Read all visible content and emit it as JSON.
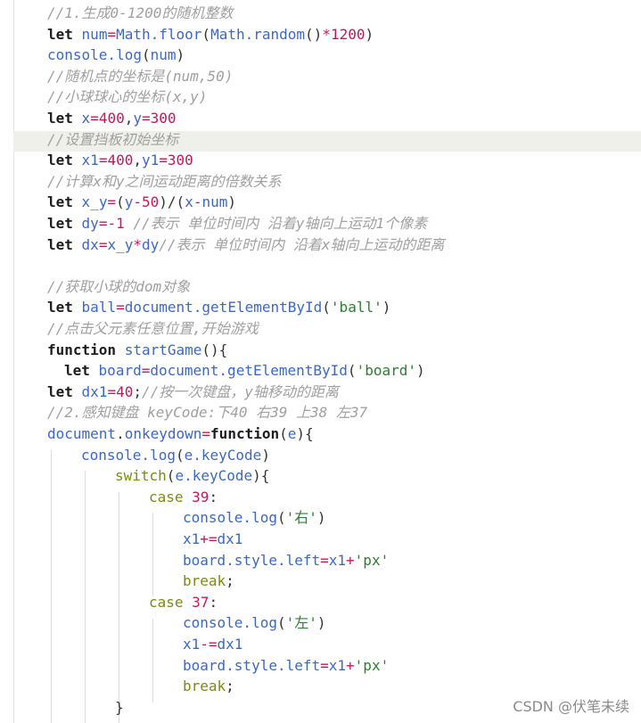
{
  "editor": {
    "language": "javascript",
    "highlighted_line": 7,
    "lines": [
      {
        "indent": 0,
        "tokens": [
          {
            "t": "comment",
            "v": "//1.生成0-1200的随机整数"
          }
        ]
      },
      {
        "indent": 0,
        "tokens": [
          {
            "t": "keyword",
            "v": "let"
          },
          {
            "t": "plain",
            "v": " "
          },
          {
            "t": "variable",
            "v": "num"
          },
          {
            "t": "op",
            "v": "="
          },
          {
            "t": "fn",
            "v": "Math.floor"
          },
          {
            "t": "plain",
            "v": "("
          },
          {
            "t": "fn",
            "v": "Math.random"
          },
          {
            "t": "plain",
            "v": "()"
          },
          {
            "t": "op",
            "v": "*"
          },
          {
            "t": "number",
            "v": "1200"
          },
          {
            "t": "plain",
            "v": ")"
          }
        ]
      },
      {
        "indent": 0,
        "tokens": [
          {
            "t": "fn",
            "v": "console.log"
          },
          {
            "t": "plain",
            "v": "("
          },
          {
            "t": "variable",
            "v": "num"
          },
          {
            "t": "plain",
            "v": ")"
          }
        ]
      },
      {
        "indent": 0,
        "tokens": [
          {
            "t": "comment",
            "v": "//随机点的坐标是(num,50)"
          }
        ]
      },
      {
        "indent": 0,
        "tokens": [
          {
            "t": "comment",
            "v": "//小球球心的坐标(x,y)"
          }
        ]
      },
      {
        "indent": 0,
        "tokens": [
          {
            "t": "keyword",
            "v": "let"
          },
          {
            "t": "plain",
            "v": " "
          },
          {
            "t": "variable",
            "v": "x"
          },
          {
            "t": "op",
            "v": "="
          },
          {
            "t": "number",
            "v": "400"
          },
          {
            "t": "plain",
            "v": ","
          },
          {
            "t": "variable",
            "v": "y"
          },
          {
            "t": "op",
            "v": "="
          },
          {
            "t": "number",
            "v": "300"
          }
        ]
      },
      {
        "indent": 0,
        "tokens": [
          {
            "t": "comment",
            "v": "//设置挡板初始坐标"
          }
        ]
      },
      {
        "indent": 0,
        "tokens": [
          {
            "t": "keyword",
            "v": "let"
          },
          {
            "t": "plain",
            "v": " "
          },
          {
            "t": "variable",
            "v": "x1"
          },
          {
            "t": "op",
            "v": "="
          },
          {
            "t": "number",
            "v": "400"
          },
          {
            "t": "plain",
            "v": ","
          },
          {
            "t": "variable",
            "v": "y1"
          },
          {
            "t": "op",
            "v": "="
          },
          {
            "t": "number",
            "v": "300"
          }
        ]
      },
      {
        "indent": 0,
        "tokens": [
          {
            "t": "comment",
            "v": "//计算x和y之间运动距离的倍数关系"
          }
        ]
      },
      {
        "indent": 0,
        "tokens": [
          {
            "t": "keyword",
            "v": "let"
          },
          {
            "t": "plain",
            "v": " "
          },
          {
            "t": "variable",
            "v": "x_y"
          },
          {
            "t": "op",
            "v": "="
          },
          {
            "t": "plain",
            "v": "("
          },
          {
            "t": "variable",
            "v": "y"
          },
          {
            "t": "op",
            "v": "-"
          },
          {
            "t": "number",
            "v": "50"
          },
          {
            "t": "plain",
            "v": ")/("
          },
          {
            "t": "variable",
            "v": "x"
          },
          {
            "t": "op",
            "v": "-"
          },
          {
            "t": "variable",
            "v": "num"
          },
          {
            "t": "plain",
            "v": ")"
          }
        ]
      },
      {
        "indent": 0,
        "tokens": [
          {
            "t": "keyword",
            "v": "let"
          },
          {
            "t": "plain",
            "v": " "
          },
          {
            "t": "variable",
            "v": "dy"
          },
          {
            "t": "op",
            "v": "=-"
          },
          {
            "t": "number",
            "v": "1"
          },
          {
            "t": "plain",
            "v": " "
          },
          {
            "t": "comment",
            "v": "//表示 单位时间内 沿着y轴向上运动1个像素"
          }
        ]
      },
      {
        "indent": 0,
        "tokens": [
          {
            "t": "keyword",
            "v": "let"
          },
          {
            "t": "plain",
            "v": " "
          },
          {
            "t": "variable",
            "v": "dx"
          },
          {
            "t": "op",
            "v": "="
          },
          {
            "t": "variable",
            "v": "x_y"
          },
          {
            "t": "op",
            "v": "*"
          },
          {
            "t": "variable",
            "v": "dy"
          },
          {
            "t": "comment",
            "v": "//表示 单位时间内 沿着x轴向上运动的距离"
          }
        ]
      },
      {
        "indent": 0,
        "tokens": []
      },
      {
        "indent": 0,
        "tokens": [
          {
            "t": "comment",
            "v": "//获取小球的dom对象"
          }
        ]
      },
      {
        "indent": 0,
        "tokens": [
          {
            "t": "keyword",
            "v": "let"
          },
          {
            "t": "plain",
            "v": " "
          },
          {
            "t": "variable",
            "v": "ball"
          },
          {
            "t": "op",
            "v": "="
          },
          {
            "t": "fn",
            "v": "document.getElementById"
          },
          {
            "t": "plain",
            "v": "("
          },
          {
            "t": "string",
            "v": "'ball'"
          },
          {
            "t": "plain",
            "v": ")"
          }
        ]
      },
      {
        "indent": 0,
        "tokens": [
          {
            "t": "comment",
            "v": "//点击父元素任意位置,开始游戏"
          }
        ]
      },
      {
        "indent": 0,
        "tokens": [
          {
            "t": "keyword",
            "v": "function"
          },
          {
            "t": "plain",
            "v": " "
          },
          {
            "t": "fn",
            "v": "startGame"
          },
          {
            "t": "plain",
            "v": "(){"
          }
        ]
      },
      {
        "indent": 1,
        "tokens": [
          {
            "t": "keyword",
            "v": "let"
          },
          {
            "t": "plain",
            "v": " "
          },
          {
            "t": "variable",
            "v": "board"
          },
          {
            "t": "op",
            "v": "="
          },
          {
            "t": "fn",
            "v": "document.getElementById"
          },
          {
            "t": "plain",
            "v": "("
          },
          {
            "t": "string",
            "v": "'board'"
          },
          {
            "t": "plain",
            "v": ")"
          }
        ]
      },
      {
        "indent": 0,
        "tokens": [
          {
            "t": "keyword",
            "v": "let"
          },
          {
            "t": "plain",
            "v": " "
          },
          {
            "t": "variable",
            "v": "dx1"
          },
          {
            "t": "op",
            "v": "="
          },
          {
            "t": "number",
            "v": "40"
          },
          {
            "t": "plain",
            "v": ";"
          },
          {
            "t": "comment",
            "v": "//按一次键盘，y轴移动的距离"
          }
        ]
      },
      {
        "indent": 0,
        "tokens": [
          {
            "t": "comment",
            "v": "//2.感知键盘 keyCode:下40 右39 上38 左37"
          }
        ]
      },
      {
        "indent": 0,
        "tokens": [
          {
            "t": "variable",
            "v": "document"
          },
          {
            "t": "plain",
            "v": "."
          },
          {
            "t": "fn",
            "v": "onkeydown"
          },
          {
            "t": "op",
            "v": "="
          },
          {
            "t": "keyword",
            "v": "function"
          },
          {
            "t": "plain",
            "v": "("
          },
          {
            "t": "variable",
            "v": "e"
          },
          {
            "t": "plain",
            "v": "){"
          }
        ]
      },
      {
        "indent": 2,
        "tokens": [
          {
            "t": "fn",
            "v": "console.log"
          },
          {
            "t": "plain",
            "v": "("
          },
          {
            "t": "variable",
            "v": "e.keyCode"
          },
          {
            "t": "plain",
            "v": ")"
          }
        ]
      },
      {
        "indent": 4,
        "tokens": [
          {
            "t": "ctrl",
            "v": "switch"
          },
          {
            "t": "plain",
            "v": "("
          },
          {
            "t": "variable",
            "v": "e.keyCode"
          },
          {
            "t": "plain",
            "v": "){"
          }
        ]
      },
      {
        "indent": 6,
        "tokens": [
          {
            "t": "ctrl",
            "v": "case"
          },
          {
            "t": "plain",
            "v": " "
          },
          {
            "t": "number",
            "v": "39"
          },
          {
            "t": "plain",
            "v": ":"
          }
        ]
      },
      {
        "indent": 8,
        "tokens": [
          {
            "t": "fn",
            "v": "console.log"
          },
          {
            "t": "plain",
            "v": "("
          },
          {
            "t": "string",
            "v": "'右'"
          },
          {
            "t": "plain",
            "v": ")"
          }
        ]
      },
      {
        "indent": 8,
        "tokens": [
          {
            "t": "variable",
            "v": "x1"
          },
          {
            "t": "op",
            "v": "+="
          },
          {
            "t": "variable",
            "v": "dx1"
          }
        ]
      },
      {
        "indent": 8,
        "tokens": [
          {
            "t": "variable",
            "v": "board.style.left"
          },
          {
            "t": "op",
            "v": "="
          },
          {
            "t": "variable",
            "v": "x1"
          },
          {
            "t": "op",
            "v": "+"
          },
          {
            "t": "string",
            "v": "'px'"
          }
        ]
      },
      {
        "indent": 8,
        "tokens": [
          {
            "t": "ctrl",
            "v": "break"
          },
          {
            "t": "plain",
            "v": ";"
          }
        ]
      },
      {
        "indent": 6,
        "tokens": [
          {
            "t": "ctrl",
            "v": "case"
          },
          {
            "t": "plain",
            "v": " "
          },
          {
            "t": "number",
            "v": "37"
          },
          {
            "t": "plain",
            "v": ":"
          }
        ]
      },
      {
        "indent": 8,
        "tokens": [
          {
            "t": "fn",
            "v": "console.log"
          },
          {
            "t": "plain",
            "v": "("
          },
          {
            "t": "string",
            "v": "'左'"
          },
          {
            "t": "plain",
            "v": ")"
          }
        ]
      },
      {
        "indent": 8,
        "tokens": [
          {
            "t": "variable",
            "v": "x1"
          },
          {
            "t": "op",
            "v": "-="
          },
          {
            "t": "variable",
            "v": "dx1"
          }
        ]
      },
      {
        "indent": 8,
        "tokens": [
          {
            "t": "variable",
            "v": "board.style.left"
          },
          {
            "t": "op",
            "v": "="
          },
          {
            "t": "variable",
            "v": "x1"
          },
          {
            "t": "op",
            "v": "+"
          },
          {
            "t": "string",
            "v": "'px'"
          }
        ]
      },
      {
        "indent": 8,
        "tokens": [
          {
            "t": "ctrl",
            "v": "break"
          },
          {
            "t": "plain",
            "v": ";"
          }
        ]
      },
      {
        "indent": 4,
        "tokens": [
          {
            "t": "plain",
            "v": "}"
          }
        ]
      }
    ]
  },
  "watermark": "CSDN @伏笔未续"
}
